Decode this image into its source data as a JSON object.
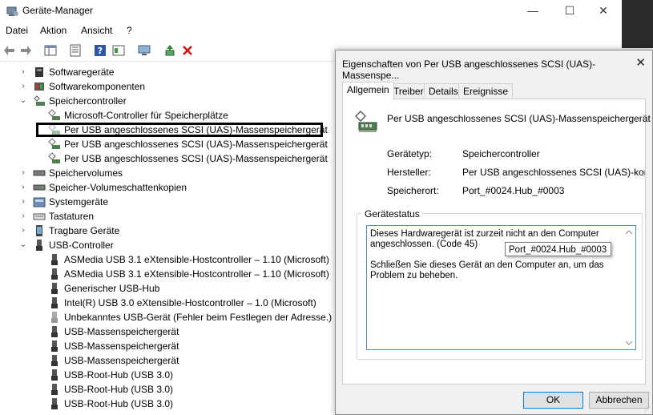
{
  "window": {
    "title": "Geräte-Manager",
    "min": "—",
    "max": "☐",
    "close": "✕"
  },
  "menu": [
    "Datei",
    "Aktion",
    "Ansicht",
    "?"
  ],
  "tree": {
    "categories": [
      {
        "label": "Softwaregeräte",
        "expanded": false,
        "icon": "chip-icon"
      },
      {
        "label": "Softwarekomponenten",
        "expanded": false,
        "icon": "component-icon"
      },
      {
        "label": "Speichercontroller",
        "expanded": true,
        "icon": "storage-controller-icon"
      },
      {
        "label": "Speichervolumes",
        "expanded": false,
        "icon": "drive-icon"
      },
      {
        "label": "Speicher-Volumeschattenkopien",
        "expanded": false,
        "icon": "drive-icon"
      },
      {
        "label": "Systemgeräte",
        "expanded": false,
        "icon": "folder-icon"
      },
      {
        "label": "Tastaturen",
        "expanded": false,
        "icon": "keyboard-icon"
      },
      {
        "label": "Tragbare Geräte",
        "expanded": false,
        "icon": "portable-icon"
      },
      {
        "label": "USB-Controller",
        "expanded": true,
        "icon": "usb-icon"
      }
    ],
    "storage_children": [
      "Microsoft-Controller für Speicherplätze",
      "Per USB angeschlossenes SCSI (UAS)-Massenspeichergerät",
      "Per USB angeschlossenes SCSI (UAS)-Massenspeichergerät",
      "Per USB angeschlossenes SCSI (UAS)-Massenspeichergerät"
    ],
    "usb_children": [
      "ASMedia USB 3.1 eXtensible-Hostcontroller – 1.10 (Microsoft)",
      "ASMedia USB 3.1 eXtensible-Hostcontroller – 1.10 (Microsoft)",
      "Generischer USB-Hub",
      "Intel(R) USB 3.0 eXtensible-Hostcontroller – 1.0 (Microsoft)",
      "Unbekanntes USB-Gerät (Fehler beim Festlegen der Adresse.)",
      "USB-Massenspeichergerät",
      "USB-Massenspeichergerät",
      "USB-Massenspeichergerät",
      "USB-Root-Hub (USB 3.0)",
      "USB-Root-Hub (USB 3.0)",
      "USB-Root-Hub (USB 3.0)"
    ]
  },
  "dialog": {
    "title": "Eigenschaften von Per USB angeschlossenes SCSI (UAS)-Massenspe...",
    "close": "✕",
    "tabs": [
      "Allgemein",
      "Treiber",
      "Details",
      "Ereignisse"
    ],
    "device_name": "Per USB angeschlossenes SCSI (UAS)-Massenspeichergerät",
    "props": {
      "type_label": "Gerätetyp:",
      "type_value": "Speichercontroller",
      "maker_label": "Hersteller:",
      "maker_value": "Per USB angeschlossenes SCSI (UAS)-kompa",
      "loc_label": "Speicherort:",
      "loc_value": "Port_#0024.Hub_#0003"
    },
    "tooltip": "Port_#0024.Hub_#0003",
    "status_group": "Gerätestatus",
    "status_line1": "Dieses Hardwaregerät ist zurzeit nicht an den Computer angeschlossen. (Code 45)",
    "status_line2": "Schließen Sie dieses Gerät an den Computer an, um das Problem zu beheben.",
    "ok": "OK",
    "cancel": "Abbrechen"
  },
  "colors": {
    "accent": "#0078d7",
    "delete": "#d11414",
    "highlight": "#000000"
  }
}
